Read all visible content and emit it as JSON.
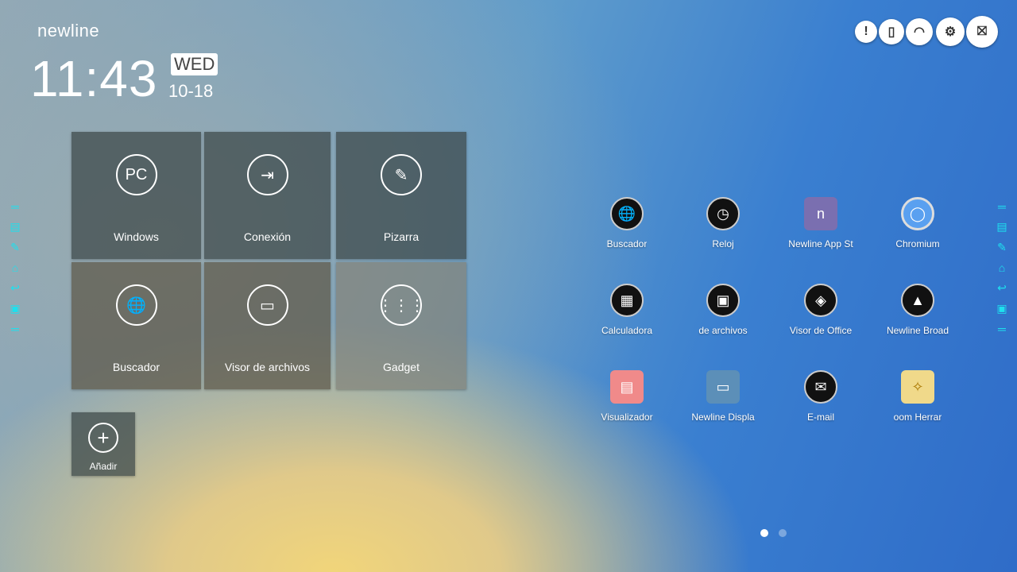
{
  "brand": "newline",
  "clock": {
    "time": "11:43",
    "day": "WED",
    "date": "10-18"
  },
  "tiles": [
    {
      "label": "Windows",
      "icon": "PC"
    },
    {
      "label": "Conexión",
      "icon": "⇥"
    },
    {
      "label": "Pizarra",
      "icon": "✎"
    },
    {
      "label": "Buscador",
      "icon": "🌐"
    },
    {
      "label": "Visor de archivos",
      "icon": "▭"
    },
    {
      "label": "Gadget",
      "icon": "⋮⋮⋮"
    }
  ],
  "add": {
    "label": "Añadir",
    "icon": "+"
  },
  "top_icons": [
    "!",
    "▯",
    "◠",
    "⚙",
    "⛝"
  ],
  "apps": [
    {
      "label": "Buscador",
      "icon": "🌐"
    },
    {
      "label": "Reloj",
      "icon": "◷"
    },
    {
      "label": "Newline App St",
      "icon": "n"
    },
    {
      "label": "Chromium",
      "icon": "◯"
    },
    {
      "label": "Calculadora",
      "icon": "▦"
    },
    {
      "label": "de archivos",
      "icon": "▣"
    },
    {
      "label": "Visor de Office",
      "icon": "◈"
    },
    {
      "label": "Newline Broad",
      "icon": "▲"
    },
    {
      "label": "Visualizador",
      "icon": "▤"
    },
    {
      "label": "Newline Displa",
      "icon": "▭"
    },
    {
      "label": "E-mail",
      "icon": "✉"
    },
    {
      "label": "oom      Herrar",
      "icon": "✧"
    }
  ],
  "side_icons": [
    "═",
    "▤",
    "✎",
    "⌂",
    "↩",
    "▣",
    "═"
  ],
  "colors": {
    "accent": "#1ee0ee"
  },
  "pager": {
    "pages": 2,
    "current": 1
  }
}
